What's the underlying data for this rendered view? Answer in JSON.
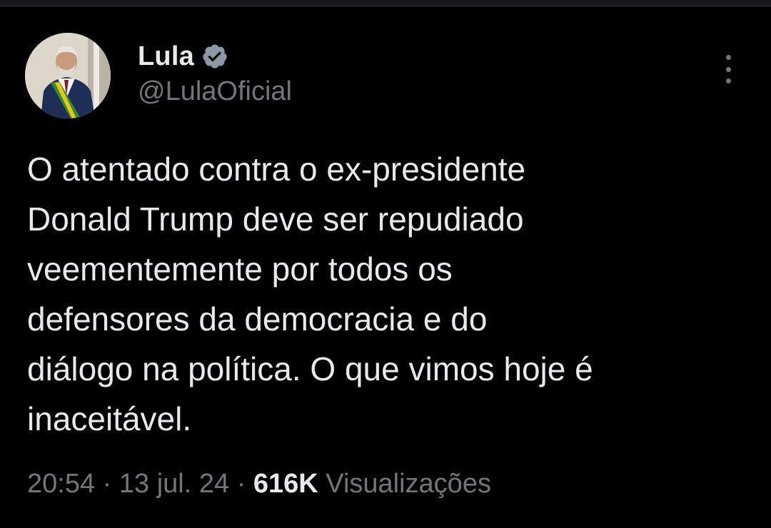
{
  "author": {
    "display_name": "Lula",
    "handle": "@LulaOficial",
    "verified": true,
    "verified_color": "#8b98a5",
    "avatar_icon": "profile-photo"
  },
  "menu_icon": "more-vertical-icon",
  "tweet": {
    "lines": [
      "O atentado contra o ex-presidente",
      "Donald Trump deve ser repudiado",
      "veementemente por todos os",
      "defensores da democracia e do",
      "diálogo na política. O que vimos hoje é",
      "inaceitável."
    ]
  },
  "meta": {
    "time": "20:54",
    "separator": "·",
    "date": "13 jul. 24",
    "views_count": "616K",
    "views_label": "Visualizações"
  },
  "colors": {
    "background": "#000000",
    "text_primary": "#e7e9ea",
    "text_secondary": "#71767b"
  }
}
